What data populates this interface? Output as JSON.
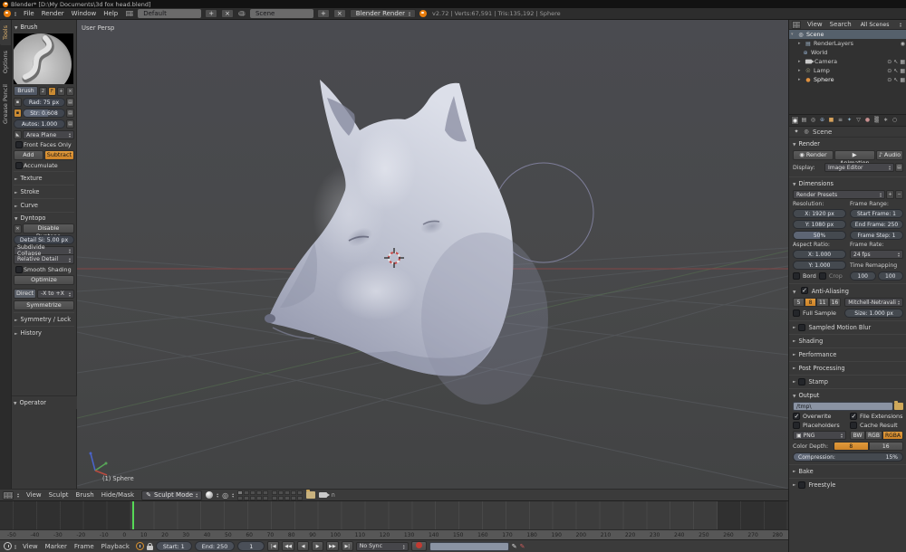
{
  "window": {
    "title": "Blender* [D:\\My Documents\\3d fox head.blend]"
  },
  "topbar": {
    "menus": [
      "File",
      "Render",
      "Window",
      "Help"
    ],
    "layout_name": "Default",
    "scene_name": "Scene",
    "engine": "Blender Render",
    "stats": "v2.72 | Verts:67,591 | Tris:135,192 | Sphere",
    "add_label": "+",
    "close_label": "×"
  },
  "icons": {
    "play": "▶",
    "play_reverse": "◀",
    "jump_start": "|◀",
    "jump_end": "▶|",
    "prev_key": "◀◀",
    "next_key": "▶▶",
    "eye": "⊙",
    "select": "↖",
    "render_restrict": "▦",
    "pencil": "✎",
    "plus": "+",
    "minus": "−",
    "close": "×",
    "x": "X",
    "scene": "◎",
    "renderlayers": "▤",
    "world": "⊕",
    "lamp": "☉",
    "sphere": "●",
    "image": "▣",
    "render_tab": "◉",
    "layers_tab": "▤",
    "scene_tab": "◎",
    "world_tab": "⊕",
    "object_tab": "■",
    "constraint_tab": "≡",
    "modifier_tab": "✦",
    "data_tab": "▽",
    "material_tab": "●",
    "texture_tab": "▒",
    "particles_tab": "∗",
    "physics_tab": "○",
    "audio": "♪",
    "camera_render": "◉",
    "animation": "▶",
    "pivot": "◎",
    "speaker": "♪"
  },
  "tool_shelf": {
    "tabs": [
      "Tools",
      "Options",
      "Grease Pencil"
    ],
    "brush_panel": {
      "title": "Brush",
      "brush_name": "Brush",
      "brush_users": "2",
      "fake_user": "F",
      "radius": "Rad: 75 px",
      "strength": "Str: 0.608",
      "autosmooth": "Autos: 1.000",
      "plane": "Area Plane",
      "front_faces": "Front Faces Only",
      "add": "Add",
      "subtract": "Subtract",
      "accumulate": "Accumulate"
    },
    "sections": {
      "texture": "Texture",
      "stroke": "Stroke",
      "curve": "Curve",
      "dyntopo": "Dyntopo",
      "symmetry": "Symmetry / Lock",
      "history": "History"
    },
    "dyntopo": {
      "disable": "Disable Dyntopo",
      "detail": "Detail Si: 5.00 px",
      "method_top": "Subdivide Collapse",
      "method_bottom": "Relative Detail",
      "smooth_shading": "Smooth Shading",
      "optimize": "Optimize",
      "direction_label": "Direct",
      "direction": "-X to +X",
      "symmetrize": "Symmetrize"
    },
    "operator": "Operator"
  },
  "viewport": {
    "view_label": "User Persp",
    "object_label": "(1) Sphere",
    "header": {
      "menus": [
        "View",
        "Sculpt",
        "Brush",
        "Hide/Mask"
      ],
      "mode": "Sculpt Mode"
    }
  },
  "outliner": {
    "menus": [
      "View",
      "Search"
    ],
    "filter": "All Scenes",
    "rows": [
      {
        "label": "Scene"
      },
      {
        "label": "RenderLayers"
      },
      {
        "label": "World"
      },
      {
        "label": "Camera"
      },
      {
        "label": "Lamp"
      },
      {
        "label": "Sphere"
      }
    ]
  },
  "properties": {
    "breadcrumb": "Scene",
    "render": {
      "title": "Render",
      "render": "Render",
      "animation": "Animation",
      "audio": "Audio",
      "display_label": "Display:",
      "display": "Image Editor"
    },
    "dimensions": {
      "title": "Dimensions",
      "presets": "Render Presets",
      "resolution_label": "Resolution:",
      "res_x": "X: 1920 px",
      "res_y": "Y: 1080 px",
      "scale": "50%",
      "frame_range_label": "Frame Range:",
      "start": "Start Frame: 1",
      "end": "End Frame: 250",
      "step": "Frame Step: 1",
      "aspect_label": "Aspect Ratio:",
      "asp_x": "X: 1.000",
      "asp_y": "Y: 1.000",
      "border": "Bord",
      "crop": "Crop",
      "fps_label": "Frame Rate:",
      "fps": "24 fps",
      "remap_label": "Time Remapping",
      "remap_a": "100",
      "remap_b": "100"
    },
    "aa": {
      "title": "Anti-Aliasing",
      "samples": [
        "5",
        "8",
        "11",
        "16"
      ],
      "filter": "Mitchell-Netravali",
      "full_sample": "Full Sample",
      "size": "Size: 1.000 px"
    },
    "collapsed": [
      "Sampled Motion Blur",
      "Shading",
      "Performance",
      "Post Processing",
      "Stamp"
    ],
    "output": {
      "title": "Output",
      "path": "/tmp\\",
      "overwrite": "Overwrite",
      "file_ext": "File Extensions",
      "placeholders": "Placeholders",
      "cache": "Cache Result",
      "format": "PNG",
      "bw": "BW",
      "rgb": "RGB",
      "rgba": "RGBA",
      "depth_label": "Color Depth:",
      "depth8": "8",
      "depth16": "16",
      "compression": "Compression:",
      "compression_val": "15%"
    },
    "bake": "Bake",
    "freestyle": "Freestyle"
  },
  "timeline": {
    "ruler": [
      "-50",
      "-40",
      "-30",
      "-20",
      "-10",
      "0",
      "10",
      "20",
      "30",
      "40",
      "50",
      "60",
      "70",
      "80",
      "90",
      "100",
      "110",
      "120",
      "130",
      "140",
      "150",
      "160",
      "170",
      "180",
      "190",
      "200",
      "210",
      "220",
      "230",
      "240",
      "250",
      "260",
      "270",
      "280"
    ],
    "footer": {
      "menus": [
        "View",
        "Marker",
        "Frame",
        "Playback"
      ],
      "start": "Start: 1",
      "end": "End: 250",
      "current": "1",
      "sync": "No Sync"
    }
  },
  "colors": {
    "accent": "#d9902d",
    "selection": "#55606b",
    "current_frame": "#57d957",
    "viewport_bg": "#47484c"
  }
}
